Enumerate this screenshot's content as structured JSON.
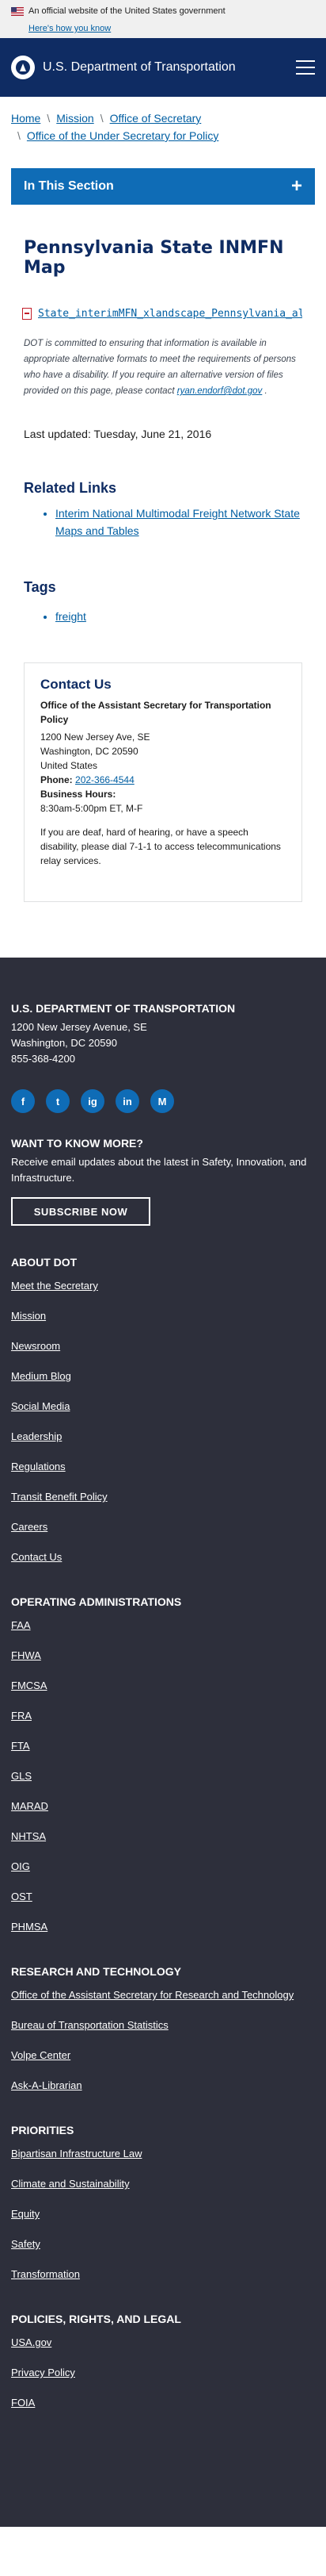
{
  "gov_banner": {
    "text": "An official website of the United States government",
    "link": "Here's how you know"
  },
  "header": {
    "title": "U.S. Department of Transportation"
  },
  "breadcrumb": {
    "items": [
      "Home",
      "Mission",
      "Office of Secretary",
      "Office of the Under Secretary for Policy"
    ]
  },
  "in_section": {
    "label": "In This Section"
  },
  "page": {
    "title": "Pennsylvania State INMFN Map",
    "file_link": "State_interimMFN_xlandscape_Pennsylvania_alt_t",
    "note": "DOT is committed to ensuring that information is available in appropriate alternative formats to meet the requirements of persons who have a disability. If you require an alternative version of files provided on this page, please contact",
    "note_email": "ryan.endorf@dot.gov",
    "updated": "Last updated: Tuesday, June 21, 2016"
  },
  "related": {
    "heading": "Related Links",
    "items": [
      "Interim National Multimodal Freight Network State Maps and Tables"
    ]
  },
  "tags": {
    "heading": "Tags",
    "items": [
      "freight"
    ]
  },
  "contact": {
    "heading": "Contact Us",
    "office": "Office of the Assistant Secretary for Transportation Policy",
    "addr1": "1200 New Jersey Ave, SE",
    "addr2": "Washington, DC 20590",
    "addr3": "United States",
    "phone_label": "Phone:",
    "phone": "202-366-4544",
    "hours_label": "Business Hours:",
    "hours": "8:30am-5:00pm ET, M-F",
    "deaf": "If you are deaf, hard of hearing, or have a speech disability, please dial 7-1-1 to access telecommunications relay services."
  },
  "footer": {
    "title": "U.S. DEPARTMENT OF TRANSPORTATION",
    "addr1": "1200 New Jersey Avenue, SE",
    "addr2": "Washington, DC 20590",
    "phone": "855-368-4200",
    "social": [
      "f",
      "t",
      "ig",
      "in",
      "M"
    ],
    "wtkm": "WANT TO KNOW MORE?",
    "wtkm_desc": "Receive email updates about the latest in Safety, Innovation, and Infrastructure.",
    "subscribe": "SUBSCRIBE NOW",
    "about": {
      "heading": "ABOUT DOT",
      "links": [
        "Meet the Secretary",
        "Mission",
        "Newsroom",
        "Medium Blog",
        "Social Media",
        "Leadership",
        "Regulations",
        "Transit Benefit Policy",
        "Careers",
        "Contact Us"
      ]
    },
    "op_admins": {
      "heading": "OPERATING ADMINISTRATIONS",
      "links": [
        "FAA",
        "FHWA",
        "FMCSA",
        "FRA",
        "FTA",
        "GLS",
        "MARAD",
        "NHTSA",
        "OIG",
        "OST",
        "PHMSA"
      ]
    },
    "research": {
      "heading": "RESEARCH AND TECHNOLOGY",
      "links": [
        "Office of the Assistant Secretary for Research and Technology",
        "Bureau of Transportation Statistics",
        "Volpe Center",
        "Ask-A-Librarian"
      ]
    },
    "priorities": {
      "heading": "PRIORITIES",
      "links": [
        "Bipartisan Infrastructure Law",
        "Climate and Sustainability",
        "Equity",
        "Safety",
        "Transformation"
      ]
    },
    "policies": {
      "heading": "POLICIES, RIGHTS, AND LEGAL",
      "links": [
        "USA.gov",
        "Privacy Policy",
        "FOIA"
      ]
    }
  }
}
